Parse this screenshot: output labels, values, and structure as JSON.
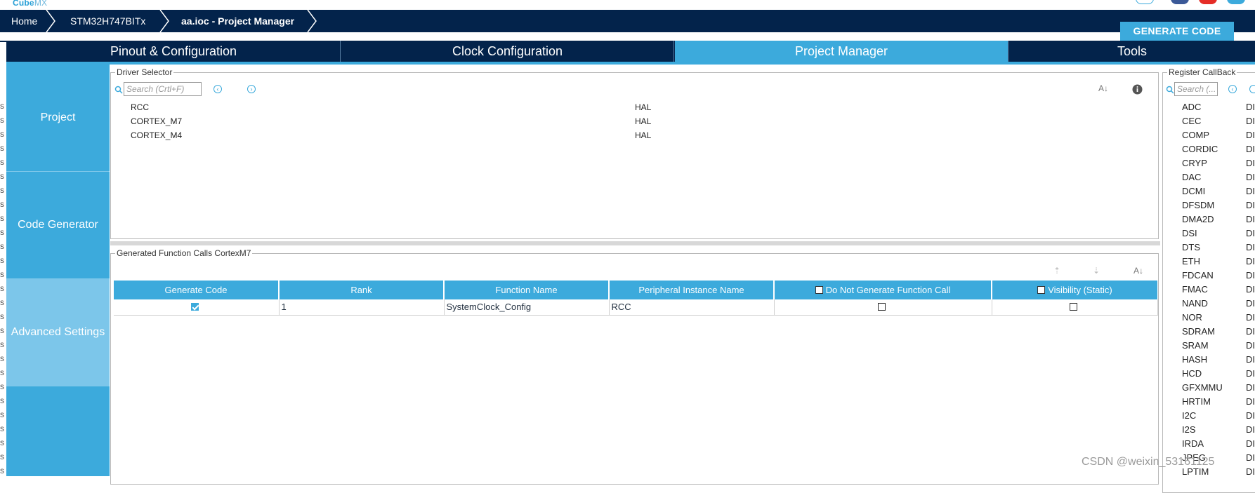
{
  "app": {
    "logo_bold": "Cube",
    "logo_thin": "MX"
  },
  "breadcrumb": [
    "Home",
    "STM32H747BITx",
    "aa.ioc - Project Manager"
  ],
  "generate_button": "GENERATE CODE",
  "tabs": [
    "Pinout & Configuration",
    "Clock Configuration",
    "Project Manager",
    "Tools"
  ],
  "sidebar": [
    "Project",
    "Code Generator",
    "Advanced Settings"
  ],
  "driver_selector": {
    "legend": "Driver Selector",
    "search_placeholder": "Search (Crtl+F)",
    "rows": [
      {
        "name": "RCC",
        "driver": "HAL"
      },
      {
        "name": "CORTEX_M7",
        "driver": "HAL"
      },
      {
        "name": "CORTEX_M4",
        "driver": "HAL"
      }
    ]
  },
  "function_calls": {
    "legend": "Generated Function Calls CortexM7",
    "columns": [
      "Generate Code",
      "Rank",
      "Function Name",
      "Peripheral Instance Name",
      "Do Not Generate Function Call",
      "Visibility (Static)"
    ],
    "rows": [
      {
        "generate": true,
        "rank": "1",
        "function": "SystemClock_Config",
        "instance": "RCC",
        "no_call": false,
        "static": false
      }
    ]
  },
  "register_callback": {
    "legend": "Register CallBack",
    "search_placeholder": "Search (...",
    "items": [
      "ADC",
      "CEC",
      "COMP",
      "CORDIC",
      "CRYP",
      "DAC",
      "DCMI",
      "DFSDM",
      "DMA2D",
      "DSI",
      "DTS",
      "ETH",
      "FDCAN",
      "FMAC",
      "NAND",
      "NOR",
      "SDRAM",
      "SRAM",
      "HASH",
      "HCD",
      "GFXMMU",
      "HRTIM",
      "I2C",
      "I2S",
      "IRDA",
      "JPEG",
      "LPTIM"
    ],
    "value_prefix": "DI"
  },
  "watermark": "CSDN @weixin_53161125",
  "colors": {
    "navy": "#03234b",
    "accent": "#3caadc",
    "accent_light": "#7cc6ea"
  }
}
